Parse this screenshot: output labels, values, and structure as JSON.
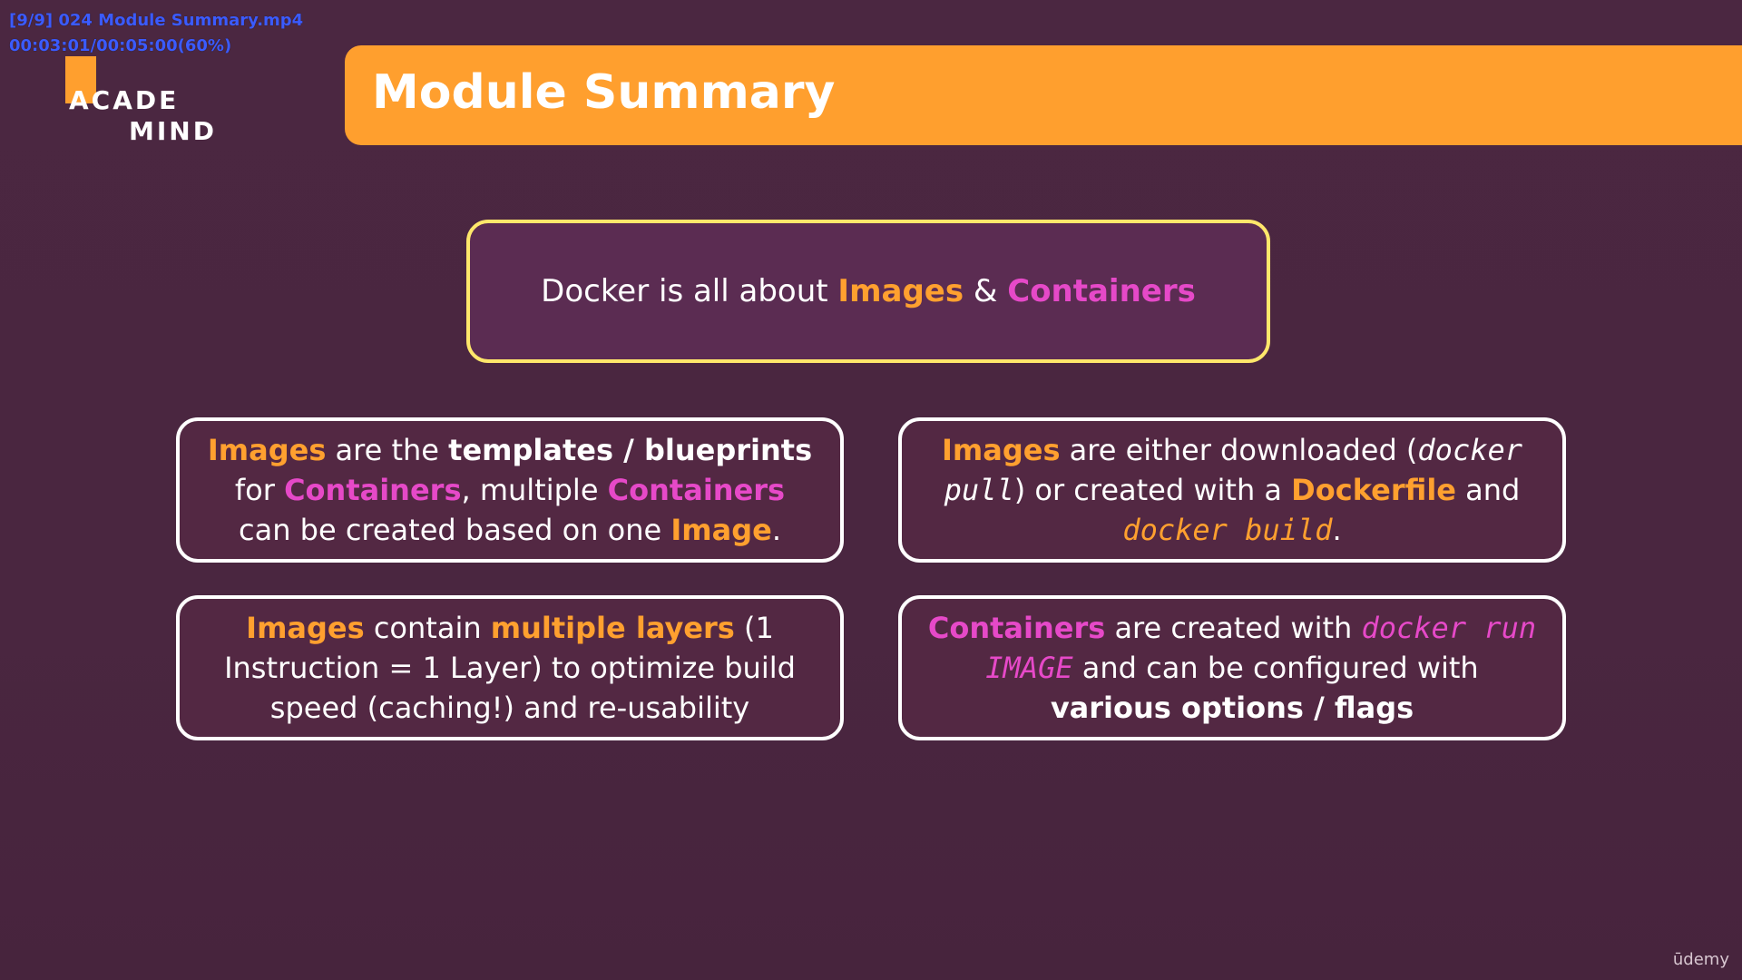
{
  "overlay": {
    "line1": "[9/9] 024 Module Summary.mp4",
    "line2": "00:03:01/00:05:00(60%)"
  },
  "logo": {
    "line1": "ACADE",
    "line2": "MIND"
  },
  "header": {
    "title": "Module Summary"
  },
  "hero": {
    "prefix": "Docker is all about ",
    "images": "Images",
    "amp": " & ",
    "containers": "Containers"
  },
  "cards": {
    "tl": {
      "images": "Images",
      "t1": " are the ",
      "templates": "templates / blueprints",
      "t2": " for ",
      "containers1": "Containers",
      "t3": ", multiple ",
      "containers2": "Containers",
      "t4": " can be created based on one ",
      "image": "Image",
      "t5": "."
    },
    "tr": {
      "images": "Images",
      "t1": " are either downloaded (",
      "pull": "docker pull",
      "t2": ") or created with a ",
      "dockerfile": "Dockerfile",
      "t3": " and ",
      "build": "docker build",
      "t4": "."
    },
    "bl": {
      "images": "Images",
      "t1": " contain ",
      "layers": "multiple layers",
      "t2": " (1 Instruction = 1 Layer) to optimize build speed (caching!) and re-usability"
    },
    "br": {
      "containers": "Containers",
      "t1": " are created with ",
      "run": "docker run IMAGE",
      "t2": " and can be configured with ",
      "options": "various options / flags"
    }
  },
  "footer": {
    "brand": "ūdemy"
  },
  "colors": {
    "background": "#4a2740",
    "accent_orange": "#ffa02f",
    "accent_pink": "#e649c8",
    "hero_border": "#ffe76b"
  }
}
